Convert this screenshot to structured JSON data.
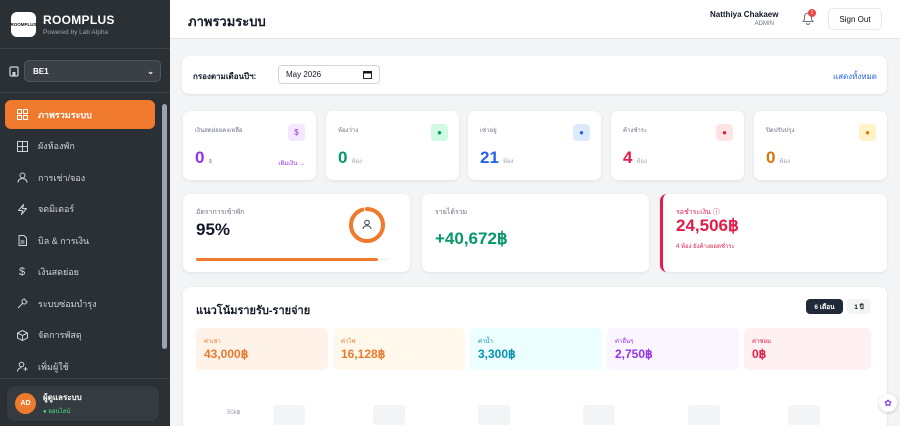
{
  "sidebar": {
    "logo_text": "ROOMPLUS",
    "brand_name": "ROOMPLUS",
    "brand_sub": "Powered by Lab Alpha",
    "building_value": "BE1",
    "items": [
      {
        "label": "ภาพรวมระบบ",
        "icon": "dashboard-icon",
        "active": true
      },
      {
        "label": "ผังห้องพัก",
        "icon": "grid-icon",
        "active": false
      },
      {
        "label": "การเช่า/จอง",
        "icon": "user-icon",
        "active": false
      },
      {
        "label": "จดมิเตอร์",
        "icon": "lightning-icon",
        "active": false
      },
      {
        "label": "บิล & การเงิน",
        "icon": "document-icon",
        "active": false
      },
      {
        "label": "เงินสดย่อย",
        "icon": "dollar-icon",
        "active": false
      },
      {
        "label": "ระบบซ่อมบำรุง",
        "icon": "wrench-icon",
        "active": false
      },
      {
        "label": "จัดการพัสดุ",
        "icon": "box-icon",
        "active": false
      },
      {
        "label": "เพิ่มผู้ใช้",
        "icon": "add-user-icon",
        "active": false
      }
    ],
    "user": {
      "initials": "AD",
      "name": "ผู้ดูแลระบบ",
      "status": "● ออนไลน์"
    }
  },
  "header": {
    "title": "ภาพรวมระบบ",
    "user_name": "Natthiya Chakaew",
    "user_role": "ADMIN",
    "notif_count": "1",
    "signout_label": "Sign Out"
  },
  "filter": {
    "label": "กรองตามเดือนปีฯ:",
    "month_value": "May 2026",
    "show_all": "แสดงทั้งหมด"
  },
  "stats": [
    {
      "label": "เงินสดย่อยคงเหลือ",
      "value": "0",
      "unit": "฿",
      "link": "เติมเงิน →",
      "color": "#9333ea",
      "icon": "$",
      "icon_bg": "#f3e8ff"
    },
    {
      "label": "ห้องว่าง",
      "value": "0",
      "unit": "ห้อง",
      "color": "#059669",
      "icon": "●",
      "icon_bg": "#d1fae5"
    },
    {
      "label": "เช่าอยู่",
      "value": "21",
      "unit": "ห้อง",
      "color": "#2563eb",
      "icon": "●",
      "icon_bg": "#dbeafe"
    },
    {
      "label": "ค้างชำระ",
      "value": "4",
      "unit": "ห้อง",
      "color": "#e11d48",
      "icon": "●",
      "icon_bg": "#ffe4e6"
    },
    {
      "label": "ปิดปรับปรุง",
      "value": "0",
      "unit": "ห้อง",
      "color": "#d97706",
      "icon": "●",
      "icon_bg": "#fef3c7"
    }
  ],
  "occupancy": {
    "label": "อัตราการเข้าพัก",
    "value": "95%",
    "percent": 95
  },
  "income": {
    "label": "รายได้รวม",
    "value": "+40,672฿"
  },
  "pending": {
    "label": "รอชำระเงิน ⓘ",
    "value": "24,506฿",
    "sub": "4 ห้อง ยังค้างยอดชำระ"
  },
  "trend": {
    "title": "แนวโน้มรายรับ-รายจ่าย",
    "seg_6m": "6 เดือน",
    "seg_1y": "1 ปี",
    "items": [
      {
        "label": "ค่าเช่า",
        "value": "43,000฿",
        "color": "#ea7a2e",
        "bg": "#fff3e9"
      },
      {
        "label": "ค่าไฟ",
        "value": "16,128฿",
        "color": "#ea7a2e",
        "bg": "#fff8eb"
      },
      {
        "label": "ค่าน้ำ",
        "value": "3,300฿",
        "color": "#0891b2",
        "bg": "#ecfeff"
      },
      {
        "label": "ค่าอื่นๆ",
        "value": "2,750฿",
        "color": "#9333ea",
        "bg": "#faf5ff"
      },
      {
        "label": "ค่าซ่อม",
        "value": "0฿",
        "color": "#e11d48",
        "bg": "#fff1f2"
      }
    ],
    "y_tick": "50k฿"
  }
}
